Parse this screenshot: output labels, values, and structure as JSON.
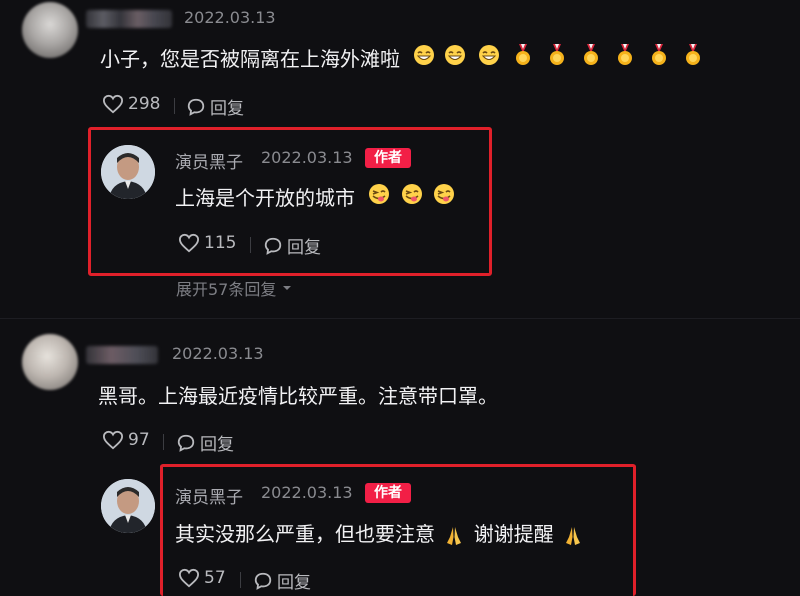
{
  "comments": [
    {
      "date": "2022.03.13",
      "text": "小子，您是否被隔离在上海外滩啦",
      "emojis": [
        "grin",
        "grin",
        "grin",
        "medal",
        "medal",
        "medal",
        "medal",
        "medal",
        "medal"
      ],
      "likes": "298",
      "reply_label": "回复",
      "reply": {
        "author": "演员黑子",
        "date": "2022.03.13",
        "badge": "作者",
        "text": "上海是个开放的城市",
        "emojis": [
          "wink",
          "wink",
          "wink"
        ],
        "likes": "115",
        "reply_label": "回复"
      },
      "expand_label": "展开57条回复"
    },
    {
      "date": "2022.03.13",
      "text": "黑哥。上海最近疫情比较严重。注意带口罩。",
      "likes": "97",
      "reply_label": "回复",
      "reply": {
        "author": "演员黑子",
        "date": "2022.03.13",
        "badge": "作者",
        "text_part1": "其实没那么严重，但也要注意",
        "text_part2": "谢谢提醒",
        "emojis": [
          "pray",
          "pray"
        ],
        "likes": "57",
        "reply_label": "回复"
      }
    }
  ],
  "colors": {
    "background": "#0f0f12",
    "highlight_border": "#e0202a",
    "author_badge": "#f21f46",
    "meta_text": "#8a8b90"
  },
  "icons": {
    "like": "heart-outline-icon",
    "reply": "speech-bubble-icon",
    "expand": "chevron-down-icon"
  }
}
